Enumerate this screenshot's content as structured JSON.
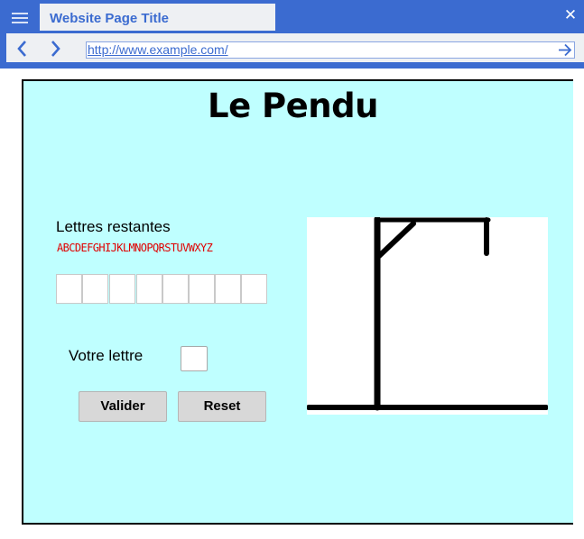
{
  "browser": {
    "tab_title": "Website Page Title",
    "url": "http://www.example.com/",
    "icons": {
      "menu": "hamburger-menu-icon",
      "close": "close-icon",
      "back": "chevron-left-icon",
      "forward": "chevron-right-icon",
      "go": "arrow-right-icon"
    },
    "accent_color": "#3b6bd0"
  },
  "game": {
    "title": "Le Pendu",
    "remaining_label": "Lettres restantes",
    "remaining_letters": "ABCDEFGHIJKLMNOPQRSTUVWXYZ",
    "word_slots": [
      "",
      "",
      "",
      "",
      "",
      "",
      "",
      ""
    ],
    "guess_label": "Votre lettre",
    "guess_value": "",
    "validate_label": "Valider",
    "reset_label": "Reset",
    "background_color": "#bfffff",
    "letters_color": "#e00000"
  }
}
